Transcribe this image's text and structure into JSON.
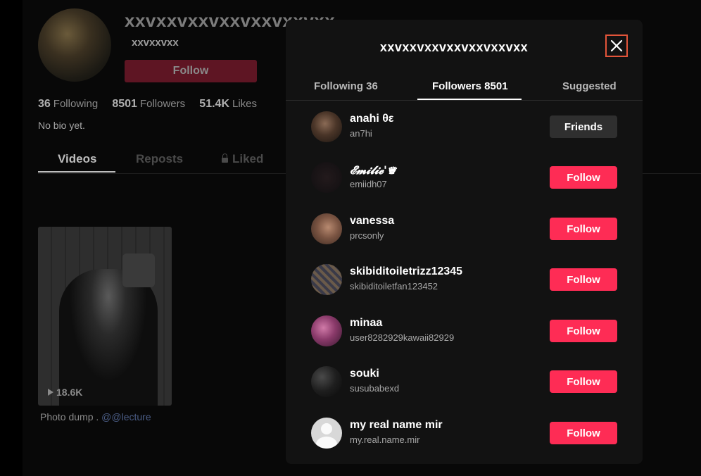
{
  "profile": {
    "display_name": "xxvxxvxxvxxvxxvxxvxx",
    "username": "xxvxxvxx",
    "follow_label": "Follow",
    "stats": [
      {
        "value": "36",
        "label": "Following"
      },
      {
        "value": "8501",
        "label": "Followers"
      },
      {
        "value": "51.4K",
        "label": "Likes"
      }
    ],
    "bio": "No bio yet.",
    "tabs": [
      "Videos",
      "Reposts",
      "Liked"
    ],
    "video": {
      "views": "18.6K",
      "caption_text": "Photo dump . ",
      "caption_mention": "@@lecture"
    }
  },
  "modal": {
    "title": "xxvxxvxxvxxvxxvxxvxx",
    "tabs": [
      "Following 36",
      "Followers 8501",
      "Suggested"
    ],
    "active_tab": "Followers 8501",
    "rows": [
      {
        "name": "anahi θε",
        "handle": "an7hi",
        "button": "Friends",
        "button_type": "friends"
      },
      {
        "name": "𝓔𝓶𝓲𝓵𝓲𝓮'♛",
        "handle": "emiidh07",
        "button": "Follow",
        "button_type": "follow"
      },
      {
        "name": "vanessa",
        "handle": "prcsonly",
        "button": "Follow",
        "button_type": "follow"
      },
      {
        "name": "skibiditoiletrizz12345",
        "handle": "skibiditoiletfan123452",
        "button": "Follow",
        "button_type": "follow"
      },
      {
        "name": "minaa",
        "handle": "user8282929kawaii82929",
        "button": "Follow",
        "button_type": "follow"
      },
      {
        "name": "souki",
        "handle": "susubabexd",
        "button": "Follow",
        "button_type": "follow"
      },
      {
        "name": "my real name mir",
        "handle": "my.real.name.mir",
        "button": "Follow",
        "button_type": "follow"
      }
    ]
  },
  "colors": {
    "accent": "#fe2c55",
    "close_focus": "#e3553a"
  },
  "icons": {
    "close": "close-icon",
    "lock": "lock-icon",
    "play": "play-icon"
  }
}
